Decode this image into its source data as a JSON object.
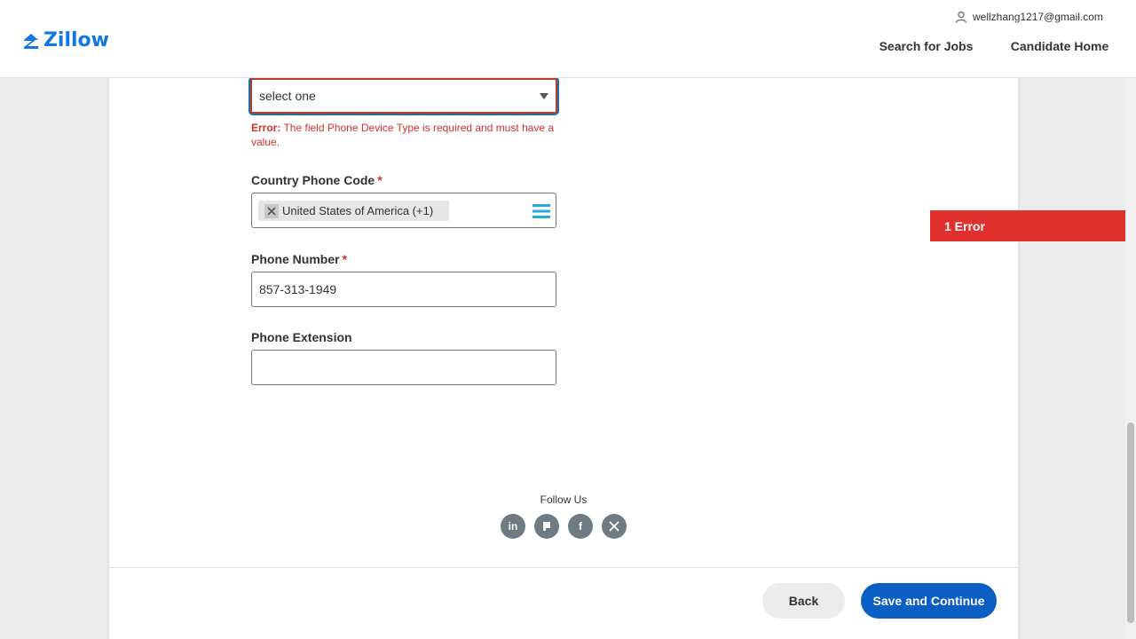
{
  "header": {
    "logo_text": "Zillow",
    "user_email": "wellzhang1217@gmail.com",
    "nav_search_jobs": "Search for Jobs",
    "nav_candidate_home": "Candidate Home"
  },
  "form": {
    "device_type": {
      "value": "select one",
      "error_prefix": "Error:",
      "error_text": "The field Phone Device Type is required and must have a value."
    },
    "country_code": {
      "label": "Country Phone Code",
      "required_mark": "*",
      "selected": "United States of America (+1)"
    },
    "phone_number": {
      "label": "Phone Number",
      "required_mark": "*",
      "value": "857-313-1949"
    },
    "phone_extension": {
      "label": "Phone Extension",
      "value": ""
    }
  },
  "footer": {
    "follow_us": "Follow Us",
    "social": [
      "linkedin-icon",
      "glassdoor-icon",
      "facebook-icon",
      "x-icon"
    ]
  },
  "actions": {
    "back_label": "Back",
    "save_label": "Save and Continue"
  },
  "error_banner": {
    "text": "1 Error"
  },
  "colors": {
    "brand": "#1277e1",
    "primary_button": "#0a5ec4",
    "error": "#d0342c"
  }
}
